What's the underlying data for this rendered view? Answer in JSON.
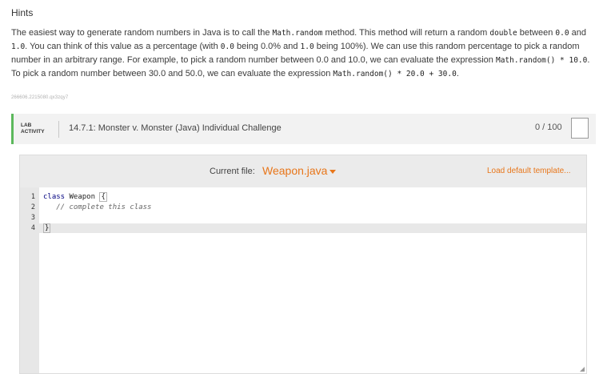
{
  "hints": {
    "title": "Hints",
    "p1": "The easiest way to generate random numbers in Java is to call the ",
    "c1": "Math.random",
    "p2": " method. This method will return a random ",
    "c2": "double",
    "p3": " between ",
    "c3": "0.0",
    "p4": " and ",
    "c4": "1.0",
    "p5": ". You can think of this value as a percentage (with ",
    "c5": "0.0",
    "p6": " being 0.0% and ",
    "c6": "1.0",
    "p7": " being 100%). We can use this random percentage to pick a random number in an arbitrary range. For example, to pick a random number between 0.0 and 10.0, we can evaluate the expression ",
    "c7": "Math.random() * 10.0",
    "p8": ". To pick a random number between 30.0 and 50.0, we can evaluate the expression ",
    "c8": "Math.random() * 20.0 + 30.0",
    "p9": ".",
    "id": "266606.2215080.qx3zqy7"
  },
  "lab": {
    "label_line1": "LAB",
    "label_line2": "ACTIVITY",
    "title": "14.7.1: Monster v. Monster (Java) Individual Challenge",
    "score": "0 / 100"
  },
  "editor": {
    "current_file_label": "Current file:",
    "file_name": "Weapon.java",
    "load_default": "Load default template...",
    "line_numbers": [
      "1",
      "2",
      "3",
      "4"
    ],
    "code": {
      "l1_kw": "class",
      "l1_name": " Weapon ",
      "l1_brace": "{",
      "l2": "   // complete this class",
      "l4_brace": "}"
    }
  },
  "colors": {
    "accent": "#e8761a",
    "lab_border": "#5cb85c"
  }
}
